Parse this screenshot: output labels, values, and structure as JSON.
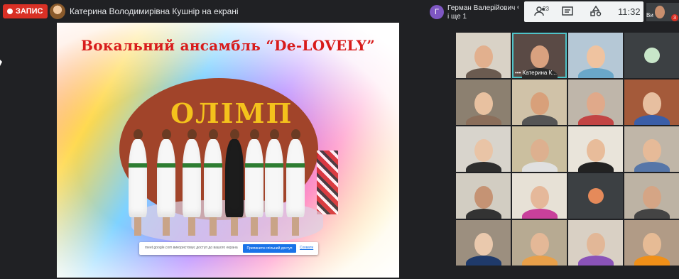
{
  "topbar": {
    "record_label": "ЗАПИС",
    "presenter_text": "Катерина Володимирівна Кушнір на екрані",
    "pinned_initial": "Г",
    "pinned_name": "Герман Валерійович Ф...",
    "pinned_sub": "і ще 1",
    "people_count": "23",
    "clock": "11:32",
    "self_label": "Ви",
    "self_badge": "3"
  },
  "slide": {
    "title": "Вокальний ансамбль “De-LOVELY”",
    "sign_text": "ОЛІМП",
    "share_text": "meet.google.com використовує доступ до вашого екрана",
    "share_button": "Припинити спільний доступ",
    "share_hide": "Сховати"
  },
  "participants": [
    {
      "label": "",
      "bg": "#d9d2c6",
      "face": "#e2b08e",
      "body": "#6b5b50"
    },
    {
      "label": "Катерина К...",
      "bg": "#5a4a45",
      "face": "#d9a17f",
      "body": "#2b2b2b",
      "active": true,
      "dots": true
    },
    {
      "label": "",
      "bg": "#b5c8d6",
      "face": "#efc3a0",
      "body": "#6aa7c9"
    },
    {
      "label": "",
      "bg": "#3c4043",
      "avatar": "#c8e6c9"
    },
    {
      "label": "",
      "bg": "#8c8070",
      "face": "#e8c1a0",
      "body": "#8b6e5a"
    },
    {
      "label": "",
      "bg": "#d0c2a8",
      "face": "#d8a07a",
      "body": "#555"
    },
    {
      "label": "",
      "bg": "#bfb6aa",
      "face": "#e0a98a",
      "body": "#c24444"
    },
    {
      "label": "",
      "bg": "#a45a3a",
      "face": "#e7bfa0",
      "body": "#3a5ea8"
    },
    {
      "label": "",
      "bg": "#d8d4cc",
      "face": "#e9c4a6",
      "body": "#2e2e2e"
    },
    {
      "label": "",
      "bg": "#cbbf9f",
      "face": "#ddb08f",
      "body": "#e0e0e0"
    },
    {
      "label": "",
      "bg": "#e9e4da",
      "face": "#e8bc9a",
      "body": "#222"
    },
    {
      "label": "",
      "bg": "#c0b6a8",
      "face": "#e6ba98",
      "body": "#5676a8"
    },
    {
      "label": "",
      "bg": "#d2cdc2",
      "face": "#c59374",
      "body": "#333"
    },
    {
      "label": "",
      "bg": "#e7e1d6",
      "face": "#e5b89a",
      "body": "#c8409b"
    },
    {
      "label": "",
      "bg": "#3c4043",
      "avatar": "#e58a5a"
    },
    {
      "label": "",
      "bg": "#bdb3a4",
      "face": "#d5a585",
      "body": "#444"
    },
    {
      "label": "",
      "bg": "#9c8f7f",
      "face": "#eac9ad",
      "body": "#1f3a6a"
    },
    {
      "label": "",
      "bg": "#b7aa92",
      "face": "#e4b897",
      "body": "#e8a04a"
    },
    {
      "label": "",
      "bg": "#d9d0c4",
      "face": "#e2b797",
      "body": "#8a53b8"
    },
    {
      "label": "",
      "bg": "#b19b86",
      "face": "#e6bb95",
      "body": "#f09018"
    }
  ]
}
